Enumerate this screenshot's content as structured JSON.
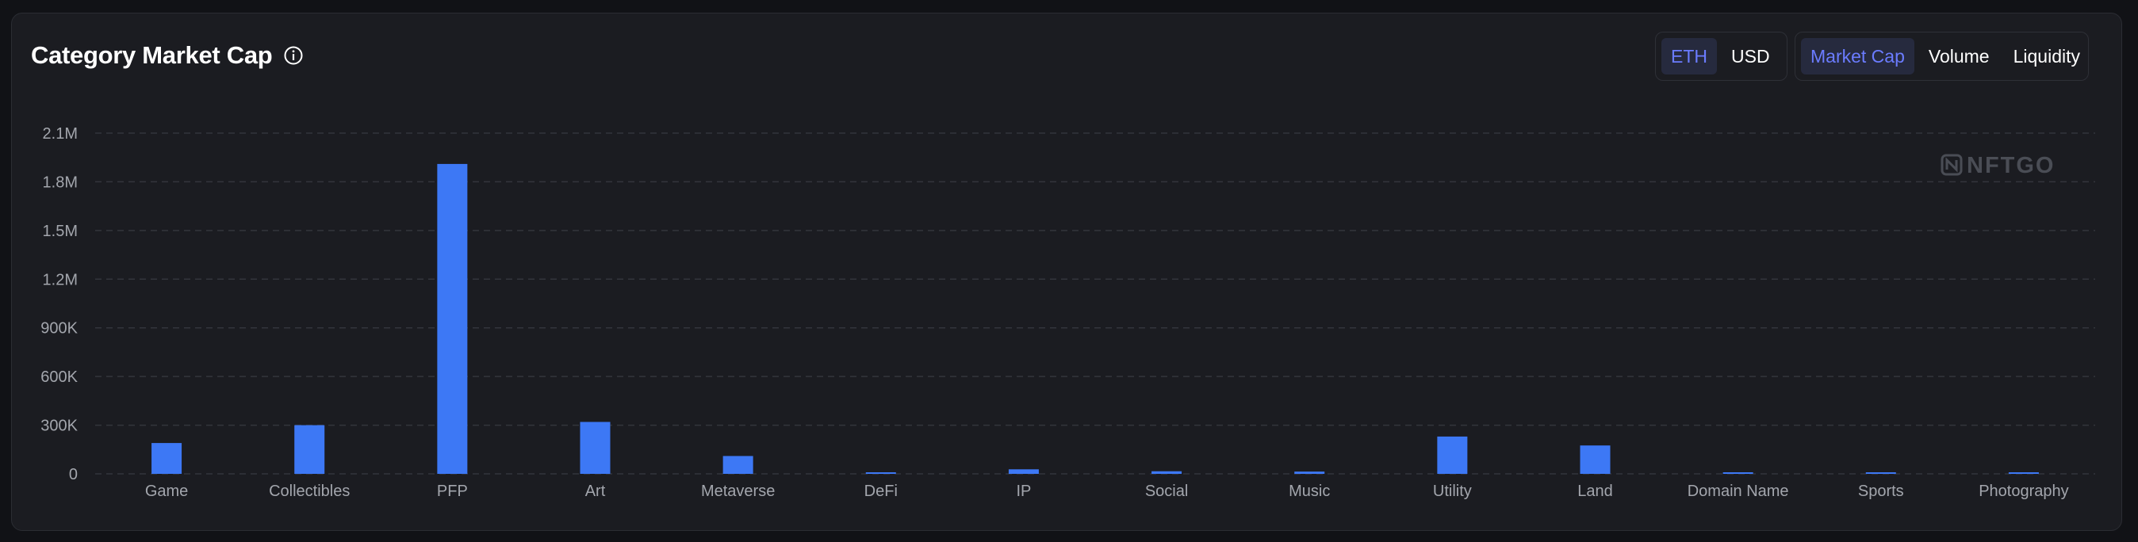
{
  "header": {
    "title": "Category Market Cap",
    "info_icon": "info-circle-icon"
  },
  "currency_toggle": {
    "options": [
      "ETH",
      "USD"
    ],
    "selected": "ETH"
  },
  "metric_toggle": {
    "options": [
      "Market Cap",
      "Volume",
      "Liquidity"
    ],
    "selected": "Market Cap"
  },
  "watermark": "NFTGO",
  "colors": {
    "bar": "#3d78f5",
    "accent": "#6b7cff",
    "background": "#1b1c21"
  },
  "chart_data": {
    "type": "bar",
    "title": "Category Market Cap",
    "xlabel": "",
    "ylabel": "",
    "categories": [
      "Game",
      "Collectibles",
      "PFP",
      "Art",
      "Metaverse",
      "DeFi",
      "IP",
      "Social",
      "Music",
      "Utility",
      "Land",
      "Domain Name",
      "Sports",
      "Photography"
    ],
    "values": [
      190000,
      300000,
      1910000,
      320000,
      110000,
      8000,
      28000,
      16000,
      14000,
      230000,
      175000,
      5000,
      5000,
      7000
    ],
    "ylim": [
      0,
      2100000
    ],
    "y_ticks": [
      0,
      300000,
      600000,
      900000,
      1200000,
      1500000,
      1800000,
      2100000
    ],
    "y_tick_labels": [
      "0",
      "300K",
      "600K",
      "900K",
      "1.2M",
      "1.5M",
      "1.8M",
      "2.1M"
    ],
    "grid": true,
    "legend": "none"
  }
}
